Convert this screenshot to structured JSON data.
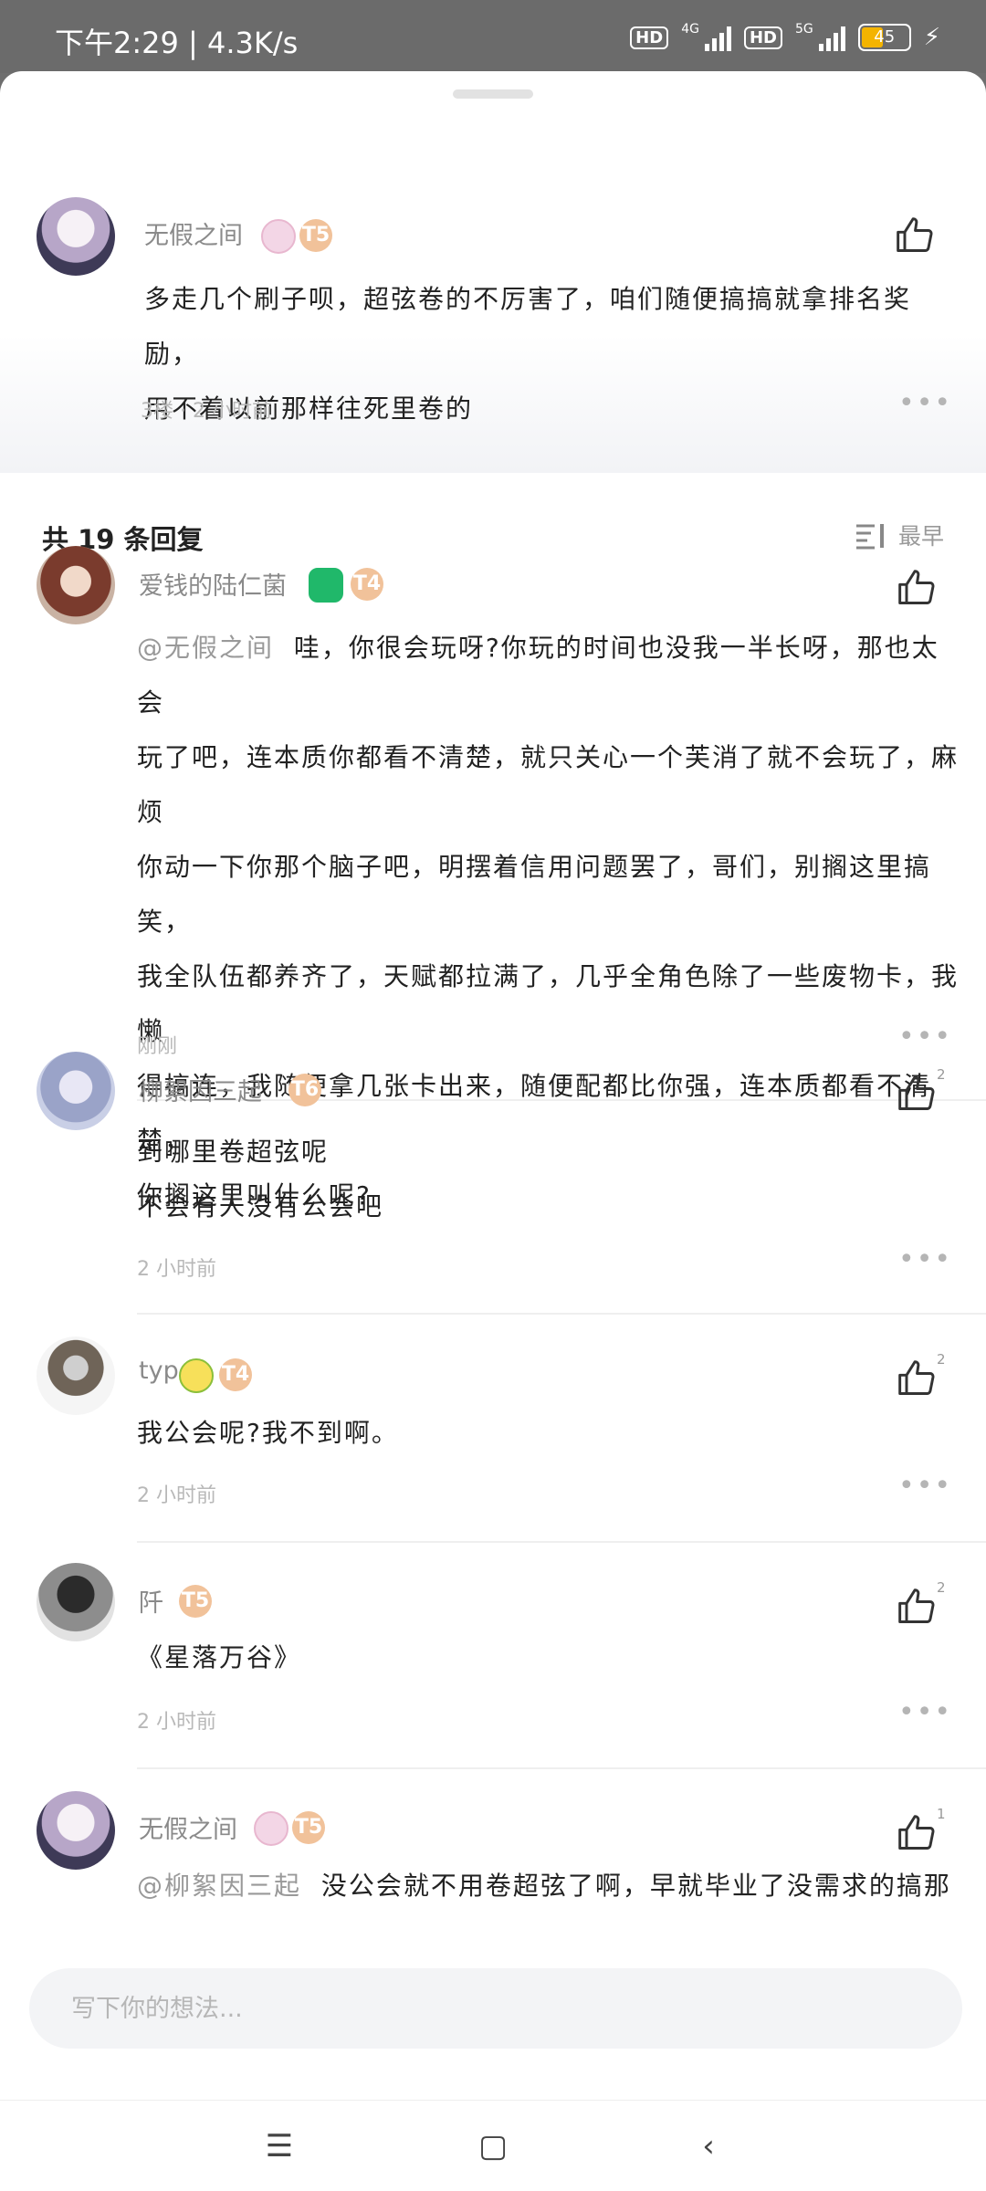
{
  "status_bar": {
    "time": "下午2:29 | 4.3K/s",
    "hd1": "HD",
    "net1": "4G",
    "hd2": "HD",
    "net2": "5G",
    "battery": "45"
  },
  "top_comment": {
    "author": "无假之间",
    "level": "T5",
    "text_lines": [
      "多走几个刷子呗，超弦卷的不厉害了，咱们随便搞搞就拿排名奖励，",
      "用不着以前那样往死里卷的"
    ],
    "meta": "3楼 · 2 小时前"
  },
  "replies_header": {
    "count_label": "共 19 条回复",
    "sort_label": "最早"
  },
  "replies": [
    {
      "author": "爱钱的陆仁菌",
      "level": "T4",
      "mention": "@无假之间",
      "text_lines": [
        "哇，你很会玩呀?你玩的时间也没我一半长呀，那也太会",
        "玩了吧，连本质你都看不清楚，就只关心一个芙消了就不会玩了，麻烦",
        "你动一下你那个脑子吧，明摆着信用问题罢了，哥们，别搁这里搞笑，",
        "我全队伍都养齐了，天赋都拉满了，几乎全角色除了一些废物卡，我懒",
        "得搞连，我随便拿几张卡出来，随便配都比你强，连本质都看不清楚，",
        "你搁这里叫什么呢?"
      ],
      "meta": "刚刚",
      "likes": ""
    },
    {
      "author": "柳絮因三起",
      "level": "T6",
      "text_lines": [
        "到哪里卷超弦呢",
        "不会有人没有公会吧"
      ],
      "meta": "2 小时前",
      "likes": "2"
    },
    {
      "author": "typ",
      "level": "T4",
      "text_lines": [
        "我公会呢?我不到啊。"
      ],
      "meta": "2 小时前",
      "likes": "2"
    },
    {
      "author": "阡",
      "level": "T5",
      "text_lines": [
        "《星落万谷》"
      ],
      "meta": "2 小时前",
      "likes": "2"
    },
    {
      "author": "无假之间",
      "level": "T5",
      "mention": "@柳絮因三起",
      "text_lines": [
        "没公会就不用卷超弦了啊，早就毕业了没需求的搞那"
      ],
      "meta": "",
      "likes": "1"
    }
  ],
  "input_bar": {
    "placeholder": "写下你的想法..."
  },
  "icons": {
    "like": "thumbs-up-icon",
    "more": "more-dots-icon",
    "sort": "sort-icon",
    "nav_menu": "menu-icon",
    "nav_home": "home-icon",
    "nav_back": "back-icon"
  }
}
